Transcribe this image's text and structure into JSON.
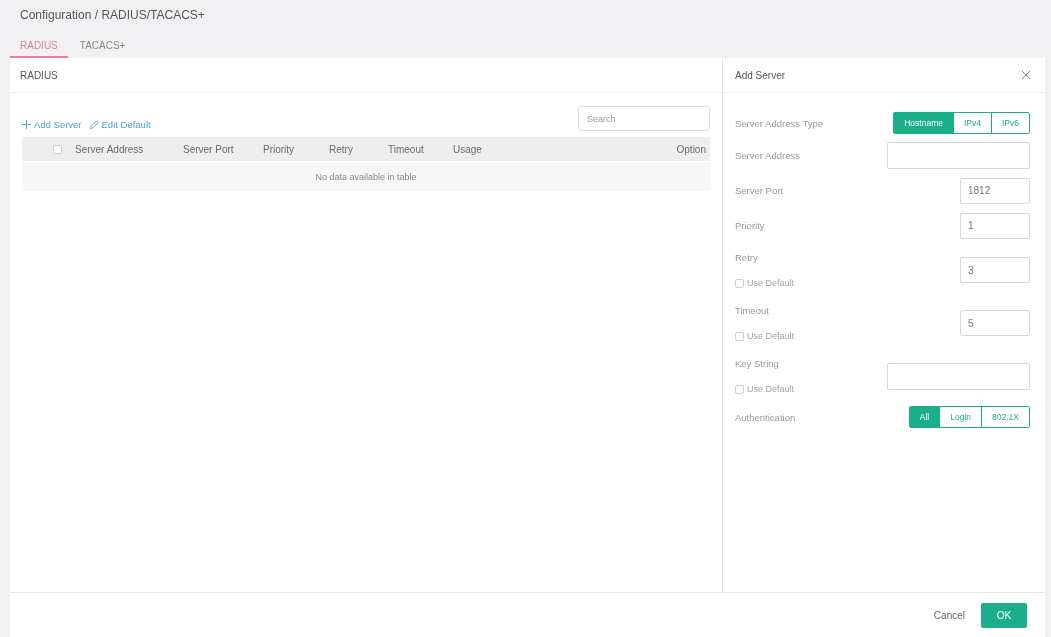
{
  "breadcrumb": "Configuration / RADIUS/TACACS+",
  "tabs": [
    {
      "label": "RADIUS",
      "selected": true
    },
    {
      "label": "TACACS+",
      "selected": false
    }
  ],
  "radius_panel": {
    "title": "RADIUS",
    "actions": [
      {
        "kind": "add",
        "label": "Add Server"
      },
      {
        "kind": "edit",
        "label": "Edit Default"
      }
    ],
    "search": {
      "placeholder": "Search"
    },
    "table": {
      "select_all": {
        "checked": false
      },
      "columns": [
        "Server Address",
        "Server Port",
        "Priority",
        "Retry",
        "Timeout",
        "Usage",
        "Option"
      ],
      "empty_message": "No data available in table"
    }
  },
  "add_server": {
    "title": "Add Server",
    "fields": [
      {
        "kind": "segmented",
        "label": "Server Address Type",
        "options": [
          {
            "label": "Hostname",
            "selected": true
          },
          {
            "label": "IPv4",
            "selected": false
          },
          {
            "label": "IPv6",
            "selected": false
          }
        ]
      },
      {
        "kind": "text",
        "label": "Server Address"
      },
      {
        "kind": "number",
        "label": "Server Port",
        "value": "1812"
      },
      {
        "kind": "number",
        "label": "Priority",
        "value": "1"
      },
      {
        "kind": "number",
        "label": "Retry",
        "value": "3",
        "use_default": {
          "label": "Use Default",
          "checked": false
        }
      },
      {
        "kind": "number",
        "label": "Timeout",
        "value": "5",
        "use_default": {
          "label": "Use Default",
          "checked": false
        }
      },
      {
        "kind": "text",
        "label": "Key String",
        "use_default": {
          "label": "Use Default",
          "checked": false
        }
      },
      {
        "kind": "segmented",
        "label": "Authentication",
        "options": [
          {
            "label": "All",
            "selected": true
          },
          {
            "label": "Login",
            "selected": false
          },
          {
            "label": "802.1X",
            "selected": false
          }
        ]
      }
    ]
  },
  "footer": {
    "buttons": [
      {
        "kind": "secondary",
        "label": "Cancel"
      },
      {
        "kind": "primary",
        "label": "OK"
      }
    ]
  }
}
